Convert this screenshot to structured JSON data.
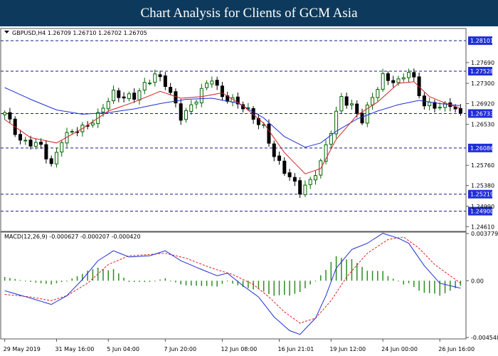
{
  "banner": {
    "title": "Chart Analysis for Clients of GCM Asia"
  },
  "colors": {
    "banner_bg": "#0d3a5c",
    "candle_up": "#006400",
    "candle_down": "#000000",
    "ma_fast": "#d42020",
    "ma_slow": "#1f2fd6",
    "level_line": "#1a1a8a",
    "price_tag_bg": "#1f2fd6",
    "macd_hist": "#2e8b22",
    "macd_line": "#1f2fd6",
    "signal_line": "#e02020",
    "grid_text": "#000000"
  },
  "chart_data": [
    {
      "type": "candlestick",
      "header": {
        "symbol": "GBPUSD,H4",
        "open": "1.26709",
        "high": "1.26710",
        "low": "1.26702",
        "close": "1.26705"
      },
      "y_axis": {
        "ylim": [
          1.2452,
          1.2833
        ],
        "ticks": [
          "1.27690",
          "1.27300",
          "1.26920",
          "1.26530",
          "1.25760",
          "1.25380",
          "1.24990",
          "1.24610"
        ]
      },
      "x_axis": {
        "labels": [
          "29 May 2019",
          "31 May 16:00",
          "5 Jun 04:00",
          "7 Jun 20:00",
          "12 Jun 08:00",
          "16 Jun 21:01",
          "19 Jun 12:00",
          "24 Jun 00:00",
          "26 Jun 16:00"
        ],
        "label_bar_index": [
          0,
          10,
          20,
          31,
          42,
          53,
          63,
          73,
          84
        ]
      },
      "levels": [
        "1.28101",
        "1.27528",
        "1.26733",
        "1.26086",
        "1.25219",
        "1.24900"
      ],
      "current_price": "1.26733",
      "price_waypoints": [
        [
          0,
          1.2672
        ],
        [
          3,
          1.2625
        ],
        [
          7,
          1.261
        ],
        [
          9,
          1.2578
        ],
        [
          11,
          1.2625
        ],
        [
          15,
          1.2648
        ],
        [
          18,
          1.2668
        ],
        [
          21,
          1.2712
        ],
        [
          25,
          1.2702
        ],
        [
          29,
          1.275
        ],
        [
          31,
          1.2728
        ],
        [
          34,
          1.2668
        ],
        [
          37,
          1.27
        ],
        [
          40,
          1.274
        ],
        [
          42,
          1.2708
        ],
        [
          44,
          1.2695
        ],
        [
          47,
          1.268
        ],
        [
          50,
          1.2645
        ],
        [
          52,
          1.2592
        ],
        [
          55,
          1.2557
        ],
        [
          57,
          1.2525
        ],
        [
          59,
          1.2545
        ],
        [
          61,
          1.2585
        ],
        [
          63,
          1.264
        ],
        [
          65,
          1.2702
        ],
        [
          67,
          1.269
        ],
        [
          69,
          1.266
        ],
        [
          71,
          1.2702
        ],
        [
          73,
          1.2745
        ],
        [
          76,
          1.273
        ],
        [
          78,
          1.2752
        ],
        [
          79,
          1.2738
        ],
        [
          81,
          1.269
        ],
        [
          84,
          1.2683
        ],
        [
          86,
          1.2695
        ],
        [
          88,
          1.267
        ]
      ],
      "ma_fast_waypoints": [
        [
          0,
          1.2662
        ],
        [
          5,
          1.2628
        ],
        [
          10,
          1.2618
        ],
        [
          15,
          1.2645
        ],
        [
          20,
          1.2678
        ],
        [
          25,
          1.2695
        ],
        [
          30,
          1.2715
        ],
        [
          34,
          1.2702
        ],
        [
          38,
          1.2705
        ],
        [
          42,
          1.2712
        ],
        [
          46,
          1.2688
        ],
        [
          50,
          1.2655
        ],
        [
          54,
          1.26
        ],
        [
          58,
          1.256
        ],
        [
          61,
          1.257
        ],
        [
          64,
          1.2625
        ],
        [
          68,
          1.267
        ],
        [
          72,
          1.2695
        ],
        [
          76,
          1.273
        ],
        [
          79,
          1.2733
        ],
        [
          82,
          1.2705
        ],
        [
          85,
          1.2693
        ],
        [
          88,
          1.2683
        ]
      ],
      "ma_slow_waypoints": [
        [
          0,
          1.2722
        ],
        [
          5,
          1.27
        ],
        [
          10,
          1.268
        ],
        [
          15,
          1.2672
        ],
        [
          20,
          1.2675
        ],
        [
          25,
          1.2682
        ],
        [
          30,
          1.2692
        ],
        [
          35,
          1.27
        ],
        [
          40,
          1.2702
        ],
        [
          45,
          1.2693
        ],
        [
          50,
          1.2665
        ],
        [
          54,
          1.263
        ],
        [
          58,
          1.261
        ],
        [
          61,
          1.2618
        ],
        [
          64,
          1.264
        ],
        [
          68,
          1.2663
        ],
        [
          72,
          1.2678
        ],
        [
          76,
          1.269
        ],
        [
          80,
          1.2698
        ],
        [
          84,
          1.2692
        ],
        [
          88,
          1.2688
        ]
      ]
    },
    {
      "type": "macd",
      "header": {
        "name": "MACD(12,26,9)",
        "macd": "-0.000627",
        "signal": "-0.000207",
        "histogram": "-0.000420"
      },
      "y_axis": {
        "ylim": [
          -0.004548,
          0.003779
        ],
        "ticks": [
          "0.003779",
          "0.00",
          "-0.004548"
        ]
      },
      "macd_waypoints": [
        [
          0,
          -0.0008
        ],
        [
          5,
          -0.0014
        ],
        [
          9,
          -0.0019
        ],
        [
          12,
          -0.0012
        ],
        [
          15,
          0.0001
        ],
        [
          18,
          0.0016
        ],
        [
          21,
          0.0024
        ],
        [
          24,
          0.0019
        ],
        [
          28,
          0.002
        ],
        [
          31,
          0.0024
        ],
        [
          34,
          0.0016
        ],
        [
          38,
          0.0009
        ],
        [
          41,
          0.0004
        ],
        [
          43,
          0.0006
        ],
        [
          46,
          -0.0004
        ],
        [
          49,
          -0.0013
        ],
        [
          52,
          -0.0029
        ],
        [
          55,
          -0.004
        ],
        [
          57,
          -0.0043
        ],
        [
          60,
          -0.003
        ],
        [
          62,
          -0.0012
        ],
        [
          64,
          0.001
        ],
        [
          67,
          0.0025
        ],
        [
          70,
          0.003
        ],
        [
          73,
          0.0038
        ],
        [
          76,
          0.0034
        ],
        [
          78,
          0.003
        ],
        [
          81,
          0.0012
        ],
        [
          84,
          -0.0002
        ],
        [
          86,
          -0.0004
        ],
        [
          88,
          -0.0006
        ]
      ],
      "signal_waypoints": [
        [
          0,
          -0.0011
        ],
        [
          5,
          -0.0013
        ],
        [
          9,
          -0.0016
        ],
        [
          12,
          -0.0012
        ],
        [
          16,
          -0.0002
        ],
        [
          20,
          0.0013
        ],
        [
          24,
          0.002
        ],
        [
          28,
          0.0021
        ],
        [
          31,
          0.0022
        ],
        [
          35,
          0.0018
        ],
        [
          40,
          0.001
        ],
        [
          44,
          0.0005
        ],
        [
          48,
          -0.0003
        ],
        [
          51,
          -0.0013
        ],
        [
          54,
          -0.0025
        ],
        [
          57,
          -0.0034
        ],
        [
          60,
          -0.003
        ],
        [
          63,
          -0.0016
        ],
        [
          66,
          0.0003
        ],
        [
          70,
          0.0022
        ],
        [
          74,
          0.0033
        ],
        [
          77,
          0.0035
        ],
        [
          80,
          0.0026
        ],
        [
          83,
          0.0013
        ],
        [
          86,
          0.0004
        ],
        [
          88,
          -0.0002
        ]
      ]
    }
  ]
}
